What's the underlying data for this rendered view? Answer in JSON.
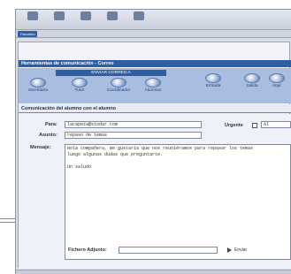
{
  "browser": {
    "toolbar_buttons": [
      {
        "label": "",
        "icon": "back-icon"
      },
      {
        "label": "",
        "icon": "forward-icon"
      },
      {
        "label": "",
        "icon": "stop-icon"
      },
      {
        "label": "",
        "icon": "refresh-icon"
      },
      {
        "label": "",
        "icon": "home-icon"
      }
    ],
    "tab_label": "Favorites"
  },
  "app": {
    "title": "Herramientas de comunicación - Correo",
    "send_group_header": "ENVIAR CORREO A",
    "nav_buttons": [
      {
        "label": "Secretaría",
        "icon": "secretaria-icon"
      },
      {
        "label": "Tutor",
        "icon": "tutor-icon"
      },
      {
        "label": "Coordinador",
        "icon": "coordinator-icon"
      },
      {
        "label": "Alumnos",
        "icon": "students-icon"
      },
      {
        "label": "Entrada",
        "icon": "inbox-icon"
      },
      {
        "label": "Salida",
        "icon": "outbox-icon"
      },
      {
        "label": "Impr",
        "icon": "print-icon"
      }
    ],
    "section_title": "Comunicación del alumno con el alumno"
  },
  "form": {
    "to_label": "Para:",
    "to_value": "lacapeza@stodar.com",
    "subject_label": "Asunto:",
    "subject_value": "repaso de temas",
    "urgent_label": "Urgente",
    "extra_value": "Al",
    "message_label": "Mensaje:",
    "message_lines": [
      "Hola compañera, me gustaría que nos reuniéramos para repasar los temas",
      "luego algunas dudas que preguntarte.",
      "",
      "Un saludo"
    ],
    "attach_label": "Fichero Adjunto:",
    "send_label": "Enviar"
  }
}
